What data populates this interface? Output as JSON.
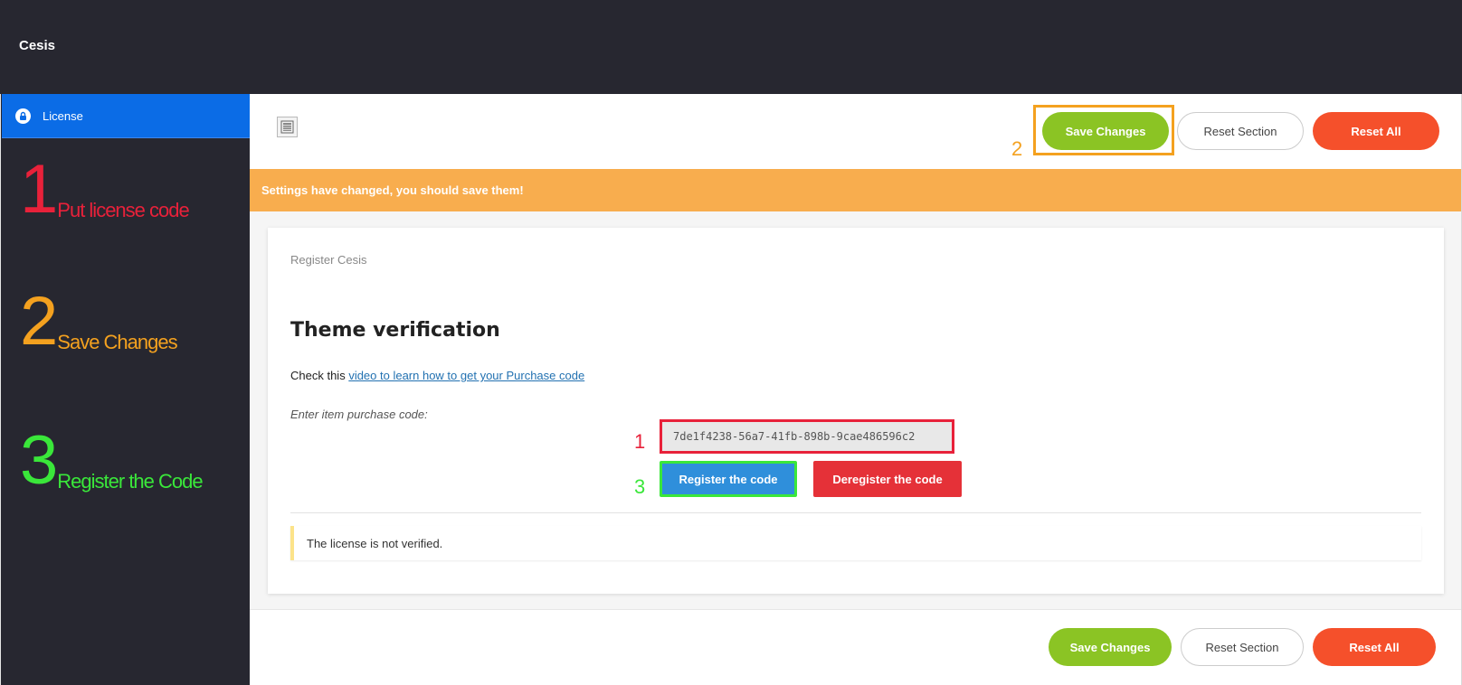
{
  "app": {
    "brand": "Cesis"
  },
  "sidebar": {
    "items": [
      {
        "label": "License",
        "icon": "lock-icon"
      }
    ]
  },
  "steps": [
    {
      "num": "1",
      "text": "Put license code",
      "color": "#e8213a"
    },
    {
      "num": "2",
      "text": "Save Changes",
      "color": "#f4a11f"
    },
    {
      "num": "3",
      "text": "Register the Code",
      "color": "#3ae73a"
    }
  ],
  "toolbar": {
    "save_label": "Save Changes",
    "reset_section_label": "Reset Section",
    "reset_all_label": "Reset All"
  },
  "markers": {
    "one": "1",
    "two": "2",
    "three": "3"
  },
  "notice": {
    "text": "Settings have changed, you should save them!"
  },
  "card": {
    "subtitle": "Register Cesis",
    "title": "Theme verification",
    "desc_prefix": "Check this ",
    "desc_link": "video to learn how to get your Purchase code",
    "input_label": "Enter item purchase code:",
    "purchase_code": "7de1f4238-56a7-41fb-898b-9cae486596c2",
    "register_label": "Register the code",
    "deregister_label": "Deregister the code",
    "status": "The license is not verified."
  },
  "footer": {
    "save_label": "Save Changes",
    "reset_section_label": "Reset Section",
    "reset_all_label": "Reset All"
  },
  "colors": {
    "sidebar_bg": "#272730",
    "active_item": "#0b6ce6",
    "save": "#8bc424",
    "reset_all": "#f5502b",
    "notice": "#f8ad4e",
    "register": "#2f8fdb",
    "deregister": "#e53138"
  }
}
